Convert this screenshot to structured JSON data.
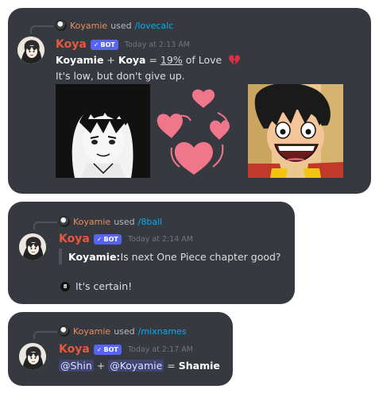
{
  "messages": [
    {
      "user": "Koyamie",
      "used": "used",
      "command": "/lovecalc",
      "bot_name": "Koya",
      "bot_badge": "BOT",
      "timestamp": "Today at 2:13 AM",
      "line1_name1": "Koyamie",
      "line1_plus": " + ",
      "line1_name2": "Koya",
      "line1_eq": " = ",
      "line1_percent": "19%",
      "line1_suffix": " of Love",
      "line2": "It's low, but don't give up."
    },
    {
      "user": "Koyamie",
      "used": "used",
      "command": "/8ball",
      "bot_name": "Koya",
      "bot_badge": "BOT",
      "timestamp": "Today at 2:14 AM",
      "question_label": "Koyamie:",
      "question": " Is next One Piece chapter good?",
      "answer": "It's certain!",
      "ball_glyph": "8"
    },
    {
      "user": "Koyamie",
      "used": "used",
      "command": "/mixnames",
      "bot_name": "Koya",
      "bot_badge": "BOT",
      "timestamp": "Today at 2:17 AM",
      "mention1": "@Shin",
      "plus": " + ",
      "mention2": "@Koyamie",
      "eq": " = ",
      "result": "Shamie"
    }
  ],
  "icons": {
    "bot_check": "✓",
    "broken_heart": "broken-heart-icon"
  },
  "colors": {
    "card_bg": "#36393f",
    "bot_name": "#e9573f",
    "user_name": "#e98e5c",
    "command": "#00aff4",
    "badge": "#5865f2",
    "hearts": "#f0778a"
  }
}
